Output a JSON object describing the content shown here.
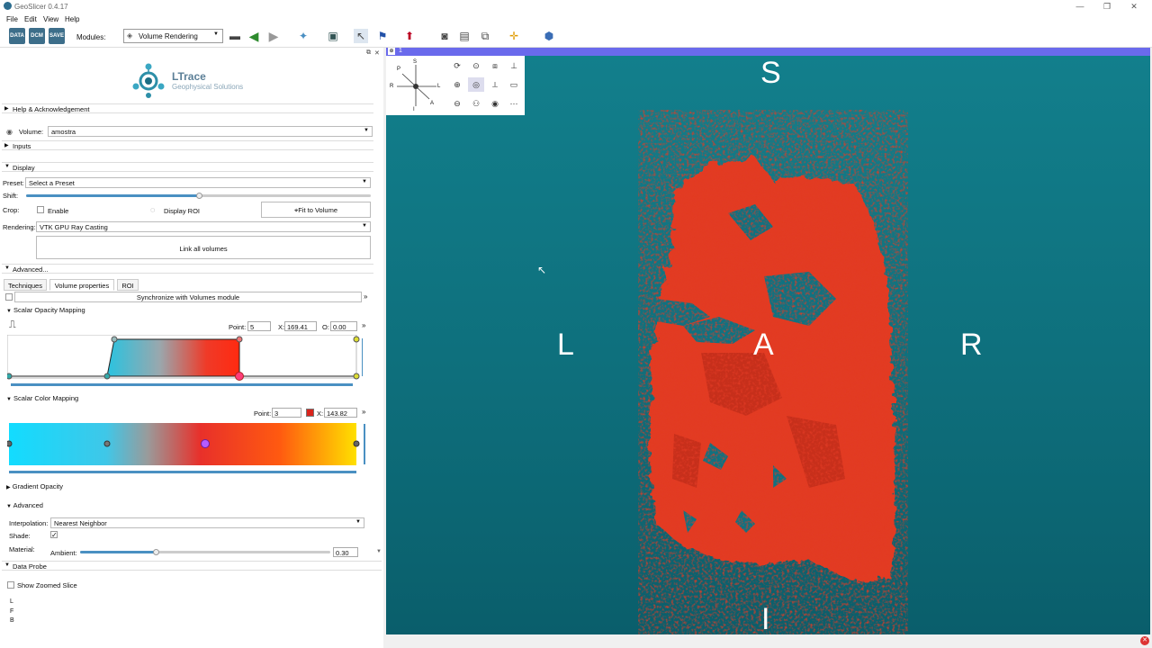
{
  "window": {
    "title": "GeoSlicer 0.4.17",
    "controls": [
      "—",
      "❐",
      "✕"
    ]
  },
  "menu": [
    "File",
    "Edit",
    "View",
    "Help"
  ],
  "toolbar": {
    "data_label": "DATA",
    "dcm_label": "DCM",
    "save_label": "SAVE",
    "modules_label": "Modules:",
    "module_selected": "Volume Rendering"
  },
  "logo": {
    "name": "LTrace",
    "sub": "Geophysical Solutions"
  },
  "sections": {
    "help": "Help & Acknowledgement",
    "inputs": "Inputs",
    "display": "Display",
    "advanced_dots": "Advanced...",
    "data_probe": "Data Probe"
  },
  "volume": {
    "label": "Volume:",
    "value": "amostra"
  },
  "display": {
    "preset_label": "Preset:",
    "preset_value": "Select a Preset",
    "shift_label": "Shift:",
    "crop_label": "Crop:",
    "enable_label": "Enable",
    "display_roi": "Display ROI",
    "fit_to_volume": "Fit to Volume",
    "rendering_label": "Rendering:",
    "rendering_value": "VTK GPU Ray Casting",
    "link_all": "Link all volumes"
  },
  "tabs": [
    "Techniques",
    "Volume properties",
    "ROI"
  ],
  "sync_button": "Synchronize with Volumes module",
  "opacity": {
    "title": "Scalar Opacity Mapping",
    "point_label": "Point:",
    "point_value": "5",
    "x_label": "X:",
    "x_value": "169.41",
    "o_label": "O:",
    "o_value": "0.00"
  },
  "color": {
    "title": "Scalar Color Mapping",
    "point_label": "Point:",
    "point_value": "3",
    "x_label": "X:",
    "x_value": "143.82",
    "swatch": "#d9241c"
  },
  "gradient": {
    "title": "Gradient Opacity"
  },
  "advanced": {
    "title": "Advanced",
    "interp_label": "Interpolation:",
    "interp_value": "Nearest Neighbor",
    "shade_label": "Shade:",
    "material_label": "Material:",
    "ambient_label": "Ambient:",
    "ambient_value": "0.30"
  },
  "probe": {
    "zoom_label": "Show Zoomed Slice",
    "lines": [
      "L",
      "F",
      "B"
    ]
  },
  "view": {
    "bg_color": "#127f8c",
    "orient_top": "S",
    "orient_left": "L",
    "orient_center": "A",
    "orient_right": "R",
    "orient_bottom": "I",
    "mini_s": "S",
    "mini_p": "P",
    "mini_r": "R",
    "mini_l": "L",
    "mini_a": "A",
    "mini_i": "I",
    "view_number": "1",
    "object_color": "#e23a24"
  }
}
